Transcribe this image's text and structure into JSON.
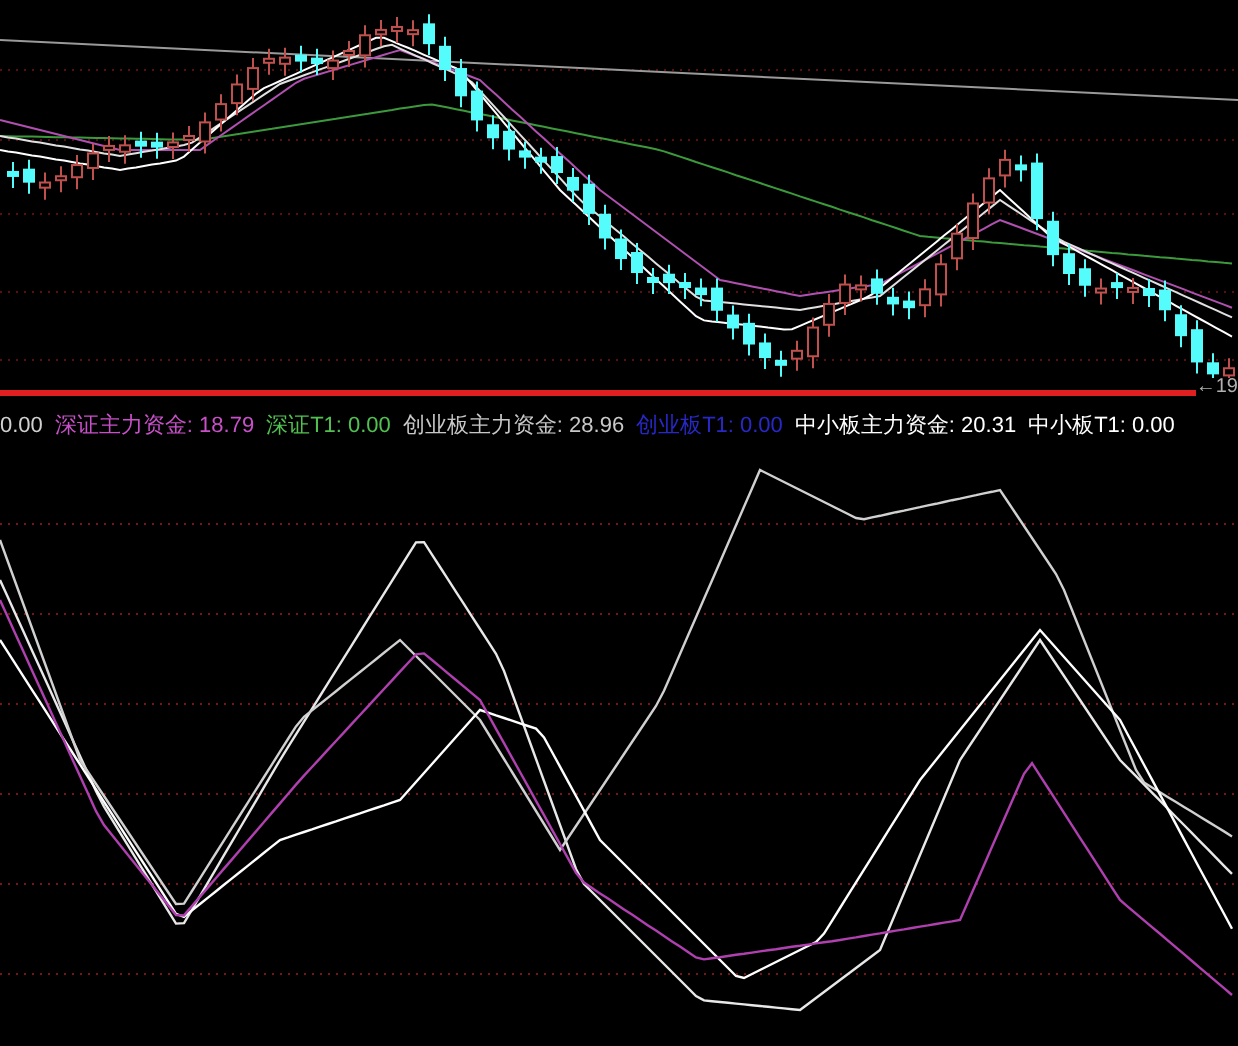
{
  "price_chart": {
    "price_label": "←19"
  },
  "indicator_legend": [
    {
      "text": "0.00",
      "color": "#d0d0d0"
    },
    {
      "text": "深证主力资金: 18.79",
      "color": "#c850c8"
    },
    {
      "text": "深证T1: 0.00",
      "color": "#50c050"
    },
    {
      "text": "创业板主力资金: 28.96",
      "color": "#c8c8c8"
    },
    {
      "text": "创业板T1: 0.00",
      "color": "#2828c8"
    },
    {
      "text": "中小板主力资金: 20.31",
      "color": "#ffffff"
    },
    {
      "text": "中小板T1: 0.00",
      "color": "#ffffff"
    }
  ]
}
